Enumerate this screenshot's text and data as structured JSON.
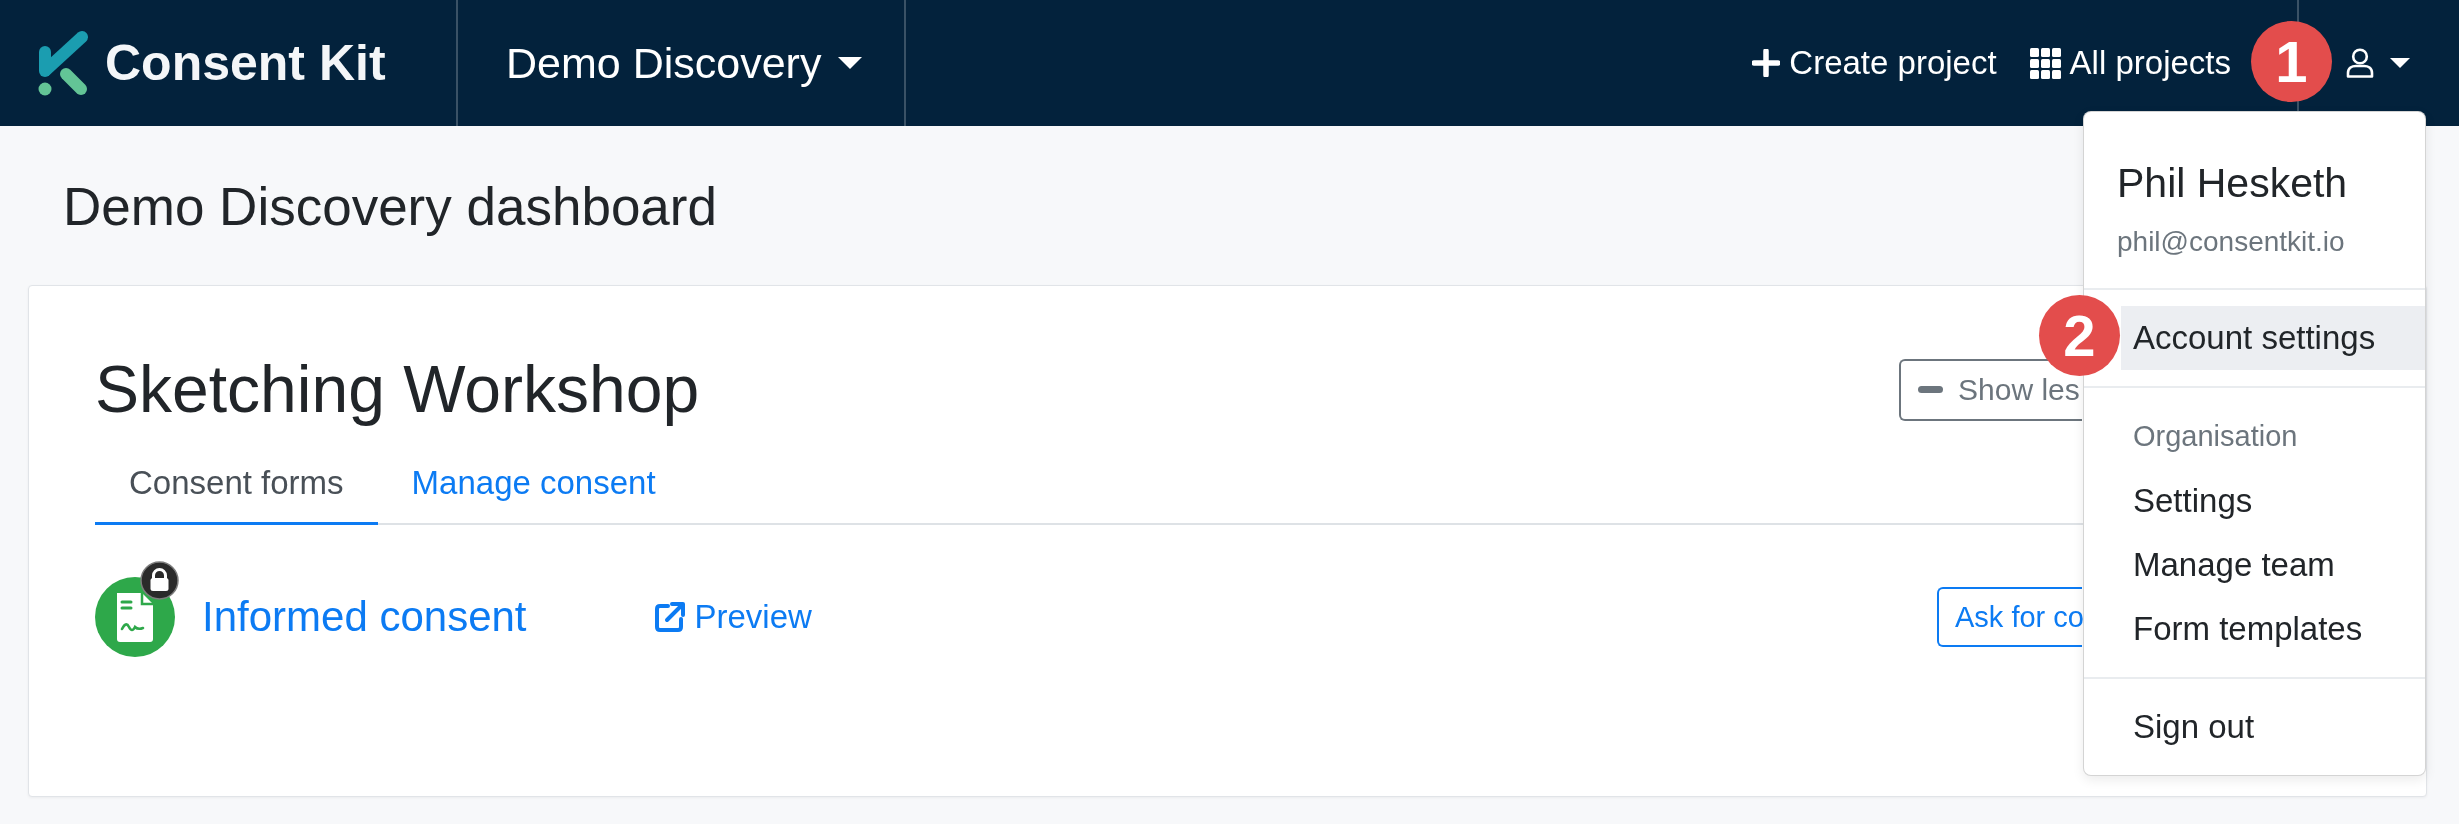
{
  "navbar": {
    "brand": "Consent Kit",
    "project_switcher": "Demo Discovery",
    "links": [
      {
        "kind": "create",
        "label": "Create project"
      },
      {
        "kind": "all_projects",
        "label": "All projects"
      }
    ]
  },
  "page": {
    "title": "Demo Discovery dashboard"
  },
  "project_card": {
    "title": "Sketching Workshop",
    "toggle_button": "Show les",
    "tabs": [
      {
        "label": "Consent forms",
        "selected": true
      },
      {
        "label": "Manage consent",
        "selected": false
      }
    ],
    "forms": [
      {
        "name": "Informed consent",
        "locked": true,
        "preview": "Preview",
        "action_button": "Ask for co"
      }
    ]
  },
  "user_menu": {
    "expanded": true,
    "name": "Phil Hesketh",
    "email": "phil@consentkit.io",
    "sections": [
      {
        "items": [
          {
            "label": "Account settings",
            "highlighted": true
          }
        ]
      },
      {
        "heading": "Organisation",
        "items": [
          {
            "label": "Settings",
            "highlighted": false
          },
          {
            "label": "Manage team",
            "highlighted": false
          },
          {
            "label": "Form templates",
            "highlighted": false
          }
        ]
      },
      {
        "items": [
          {
            "label": "Sign out",
            "highlighted": false
          }
        ]
      }
    ]
  },
  "step_markers": [
    "1",
    "2"
  ]
}
